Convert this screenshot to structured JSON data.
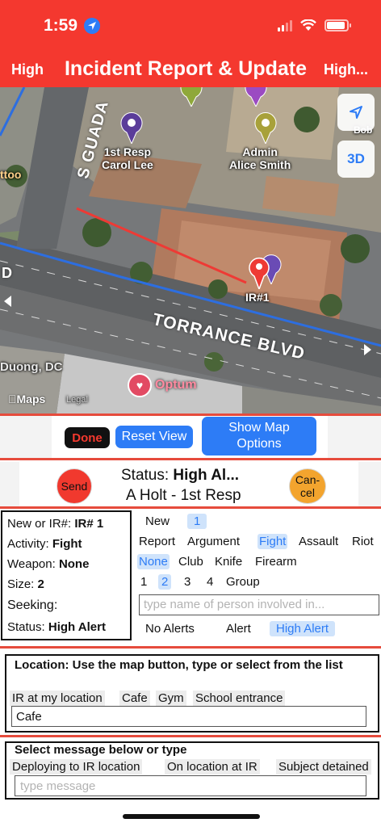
{
  "statusbar": {
    "time": "1:59"
  },
  "header": {
    "left": "High",
    "title": "Incident Report & Update",
    "right": "High..."
  },
  "map": {
    "labels": {
      "first_resp": "1st Resp\nCarol Lee",
      "admin": "Admin\nAlice Smith",
      "ir": "IR#1",
      "street_torrance": "TORRANCE BLVD",
      "street_guada": "S GUADA",
      "poi_duong": "Duong, DC",
      "poi_ttoo": "ttoo",
      "poi_bob": "Bob",
      "optum": "Optum",
      "maps": "Maps",
      "legal": "Legal",
      "road_d": "D"
    },
    "buttons": {
      "three_d": "3D"
    }
  },
  "map_controls": {
    "done": "Done",
    "reset": "Reset View",
    "show_map": "Show Map Options"
  },
  "status": {
    "send": "Send",
    "cancel": "Can-\ncel",
    "label": "Status: ",
    "value": "High Al...",
    "reporter": "A Holt - 1st Resp"
  },
  "incident": {
    "new_or_ir_label": "New or IR#:",
    "new_or_ir_value": "IR# 1",
    "activity_label": "Activity:",
    "activity_value": "Fight",
    "weapon_label": "Weapon:",
    "weapon_value": "None",
    "size_label": "Size:",
    "size_value": "2",
    "seeking_label": "Seeking:",
    "status_label": "Status:",
    "status_value": "High Alert"
  },
  "options": {
    "ir": [
      "New",
      "1"
    ],
    "activity": [
      "Report",
      "Argument",
      "Fight",
      "Assault",
      "Riot"
    ],
    "weapon": [
      "None",
      "Club",
      "Knife",
      "Firearm"
    ],
    "size": [
      "1",
      "2",
      "3",
      "4",
      "Group"
    ],
    "person_placeholder": "type name of person involved in...",
    "alerts": [
      "No Alerts",
      "Alert",
      "High Alert"
    ]
  },
  "location": {
    "title": "Location: Use the map button, type or select from the list",
    "chips": [
      "IR at my location",
      "Cafe",
      "Gym",
      "School entrance"
    ],
    "value": "Cafe"
  },
  "message": {
    "title": "Select message below or type",
    "chips": [
      "Deploying to IR location",
      "On location at IR",
      "Subject detained"
    ],
    "placeholder": "type message"
  },
  "colors": {
    "header_red": "#f4382f",
    "accent_blue": "#2d7cf6",
    "send_red": "#f1392e",
    "cancel_orange": "#f3a42e",
    "selected_bg": "#cfe3fb"
  }
}
